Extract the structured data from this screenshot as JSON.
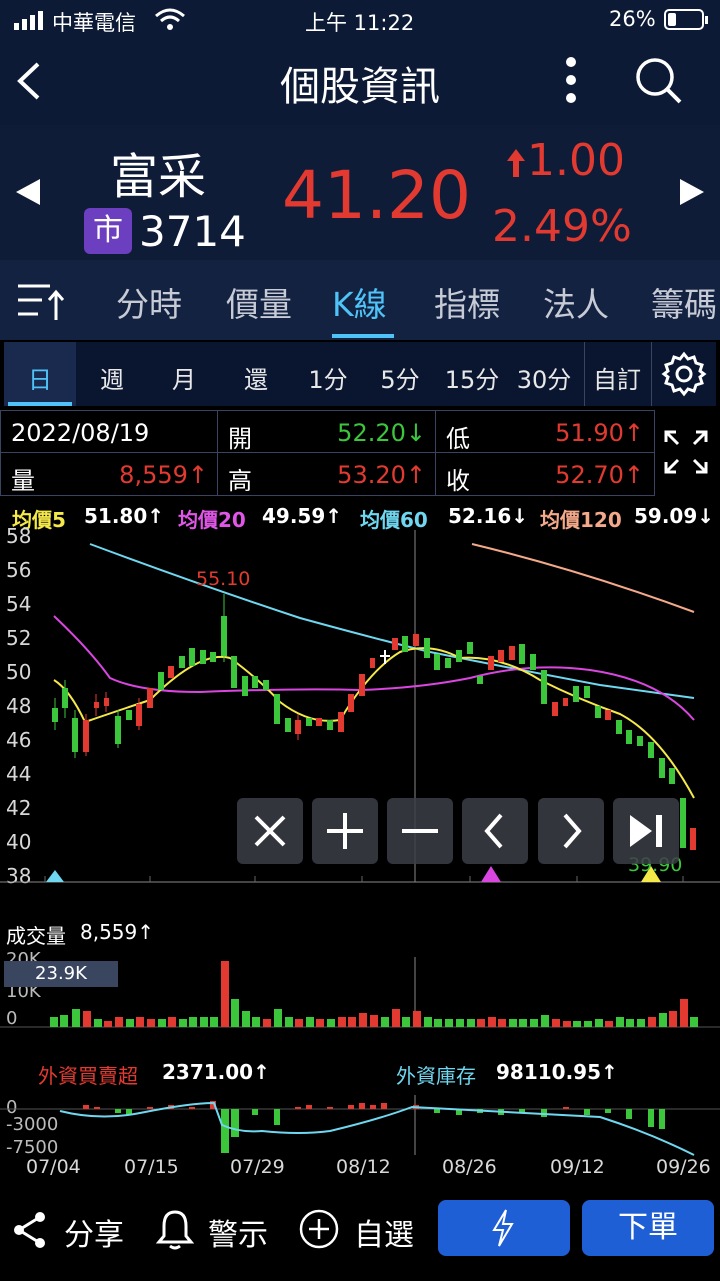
{
  "status": {
    "carrier": "中華電信",
    "time": "上午 11:22",
    "battery": "26%"
  },
  "header": {
    "title": "個股資訊"
  },
  "stock": {
    "name": "富采",
    "market_badge": "市",
    "code": "3714",
    "price": "41.20",
    "change": "1.00",
    "change_pct": "2.49%",
    "up_color": "#e23a30",
    "down_color": "#3cc63c"
  },
  "tabs": [
    {
      "label": "分時"
    },
    {
      "label": "價量"
    },
    {
      "label": "K線",
      "active": true
    },
    {
      "label": "指標"
    },
    {
      "label": "法人"
    },
    {
      "label": "籌碼"
    }
  ],
  "periods": [
    {
      "label": "日",
      "active": true
    },
    {
      "label": "週"
    },
    {
      "label": "月"
    },
    {
      "label": "還"
    },
    {
      "label": "1分"
    },
    {
      "label": "5分"
    },
    {
      "label": "15分"
    },
    {
      "label": "30分"
    },
    {
      "label": "自訂"
    }
  ],
  "info": {
    "date": "2022/08/19",
    "open_label": "開",
    "open": "52.20↓",
    "low_label": "低",
    "low": "51.90↑",
    "vol_label": "量",
    "vol": "8,559↑",
    "high_label": "高",
    "high": "53.20↑",
    "close_label": "收",
    "close": "52.70↑"
  },
  "ma": {
    "ma5_label": "均價5",
    "ma5": "51.80↑",
    "ma20_label": "均價20",
    "ma20": "49.59↑",
    "ma60_label": "均價60",
    "ma60": "52.16↓",
    "ma120_label": "均價120",
    "ma120": "59.09↓"
  },
  "kline": {
    "y_ticks": [
      "58",
      "56",
      "54",
      "52",
      "50",
      "48",
      "46",
      "44",
      "42",
      "40",
      "38"
    ],
    "high_marker": "55.10",
    "low_marker": "39.90"
  },
  "volume": {
    "label": "成交量",
    "value": "8,559↑",
    "max_box": "23.9K",
    "ticks": [
      "20K",
      "10K",
      "0"
    ]
  },
  "foreign": {
    "net_label": "外資買賣超",
    "net_value": "2371.00↑",
    "hold_label": "外資庫存",
    "hold_value": "98110.95↑",
    "ticks": [
      "0",
      "-3000",
      "-7500"
    ]
  },
  "x_dates": [
    "07/04",
    "07/15",
    "07/29",
    "08/12",
    "08/26",
    "09/12",
    "09/26"
  ],
  "bottom": {
    "share": "分享",
    "alert": "警示",
    "watch": "自選",
    "order": "下單"
  }
}
